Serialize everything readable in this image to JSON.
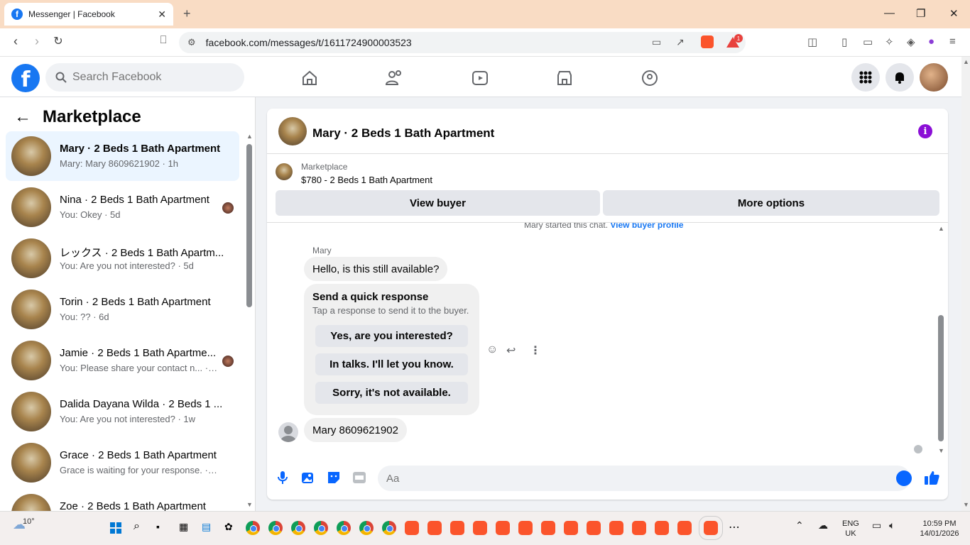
{
  "browser": {
    "tab_title": "Messenger | Facebook",
    "url": "facebook.com/messages/t/1611724900003523",
    "notification_count": "1"
  },
  "facebook": {
    "search_placeholder": "Search Facebook"
  },
  "left_panel": {
    "title": "Marketplace",
    "conversations": [
      {
        "title": "Mary · 2 Beds 1 Bath Apartment",
        "subtitle": "Mary: Mary 8609621902 · 1h"
      },
      {
        "title": "Nina · 2 Beds 1 Bath Apartment",
        "subtitle": "You: Okey · 5d"
      },
      {
        "title": "レックス · 2 Beds 1 Bath Apartm...",
        "subtitle": "You: Are you not interested? · 5d"
      },
      {
        "title": "Torin · 2 Beds 1 Bath Apartment",
        "subtitle": "You: ?? · 6d"
      },
      {
        "title": "Jamie · 2 Beds 1 Bath Apartme...",
        "subtitle": "You: Please share your contact n... · 1w"
      },
      {
        "title": "Dalida Dayana Wilda · 2 Beds 1 ...",
        "subtitle": "You: Are you not interested? · 1w"
      },
      {
        "title": "Grace · 2 Beds 1 Bath Apartment",
        "subtitle": "Grace is waiting for your response. · 1w"
      },
      {
        "title": "Zoe · 2 Beds 1 Bath Apartment",
        "subtitle": ""
      }
    ]
  },
  "chat": {
    "title": "Mary · 2 Beds 1 Bath Apartment",
    "marketplace_label": "Marketplace",
    "listing": "$780 - 2 Beds 1 Bath Apartment",
    "view_buyer": "View buyer",
    "more_options": "More options",
    "started_text": "Mary started this chat.",
    "view_buyer_profile": "View buyer profile",
    "sender_name": "Mary",
    "message_1": "Hello, is this still available?",
    "quick_title": "Send a quick response",
    "quick_subtitle": "Tap a response to send it to the buyer.",
    "quick_options": [
      "Yes, are you interested?",
      "In talks. I'll let you know.",
      "Sorry, it's not available."
    ],
    "message_2": "Mary 8609621902",
    "composer_placeholder": "Aa"
  },
  "taskbar": {
    "temperature": "10°",
    "lang_1": "ENG",
    "lang_2": "UK",
    "time": "10:59 PM",
    "date": "14/01/2026"
  },
  "colors": {
    "facebook_blue": "#1877f2",
    "messenger_blue": "#0866ff",
    "info_purple": "#8b0fd6",
    "tabstrip": "#f9dcc4"
  }
}
